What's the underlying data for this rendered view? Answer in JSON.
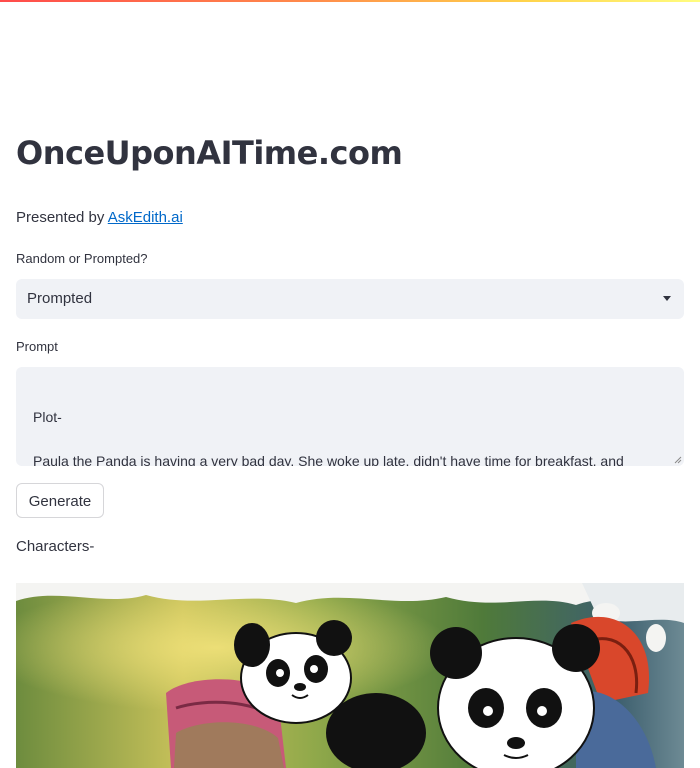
{
  "app": {
    "title": "OnceUponAITime.com",
    "presented_prefix": "Presented by ",
    "presented_link": "AskEdith.ai"
  },
  "mode_select": {
    "label": "Random or Prompted?",
    "value": "Prompted"
  },
  "prompt": {
    "label": "Prompt",
    "lines": [
      "Plot-",
      "Paula the Panda is having a very bad day. She woke up late, didn't have time for breakfast, and"
    ]
  },
  "generate_button": {
    "label": "Generate"
  },
  "output": {
    "characters_heading": "Characters-"
  },
  "colors": {
    "accent_link": "#0068c9",
    "input_background": "#f0f2f6",
    "text": "#31333f"
  }
}
